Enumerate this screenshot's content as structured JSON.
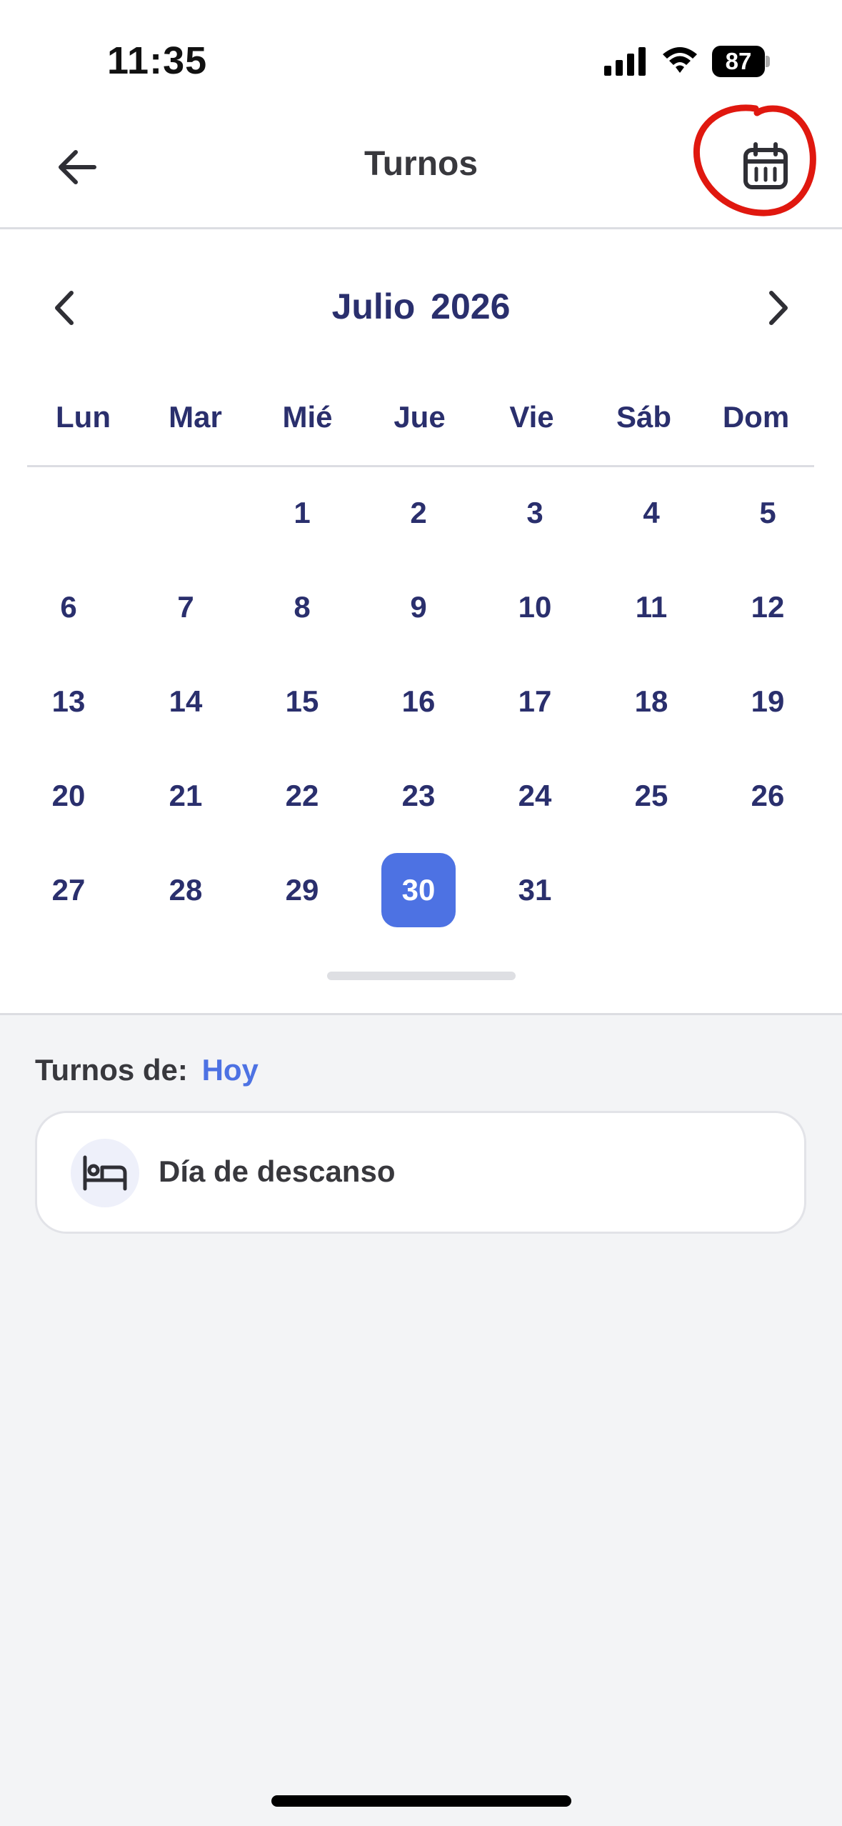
{
  "status_bar": {
    "time": "11:35",
    "battery": "87"
  },
  "header": {
    "title": "Turnos",
    "back_icon": "arrow-left-icon",
    "calendar_icon": "calendar-icon"
  },
  "calendar": {
    "month": "Julio",
    "year": "2026",
    "weekdays": [
      "Lun",
      "Mar",
      "Mié",
      "Jue",
      "Vie",
      "Sáb",
      "Dom"
    ],
    "first_weekday_index": 2,
    "days_in_month": 31,
    "selected_day": 30,
    "selected_color": "#4d72e3"
  },
  "shifts": {
    "label": "Turnos de:",
    "day": "Hoy",
    "items": [
      {
        "title": "Día de descanso",
        "icon": "bed-icon"
      }
    ]
  },
  "colors": {
    "accent": "#4d72e3",
    "calendar_text": "#2a2f6d",
    "annotation": "#e0180f"
  }
}
